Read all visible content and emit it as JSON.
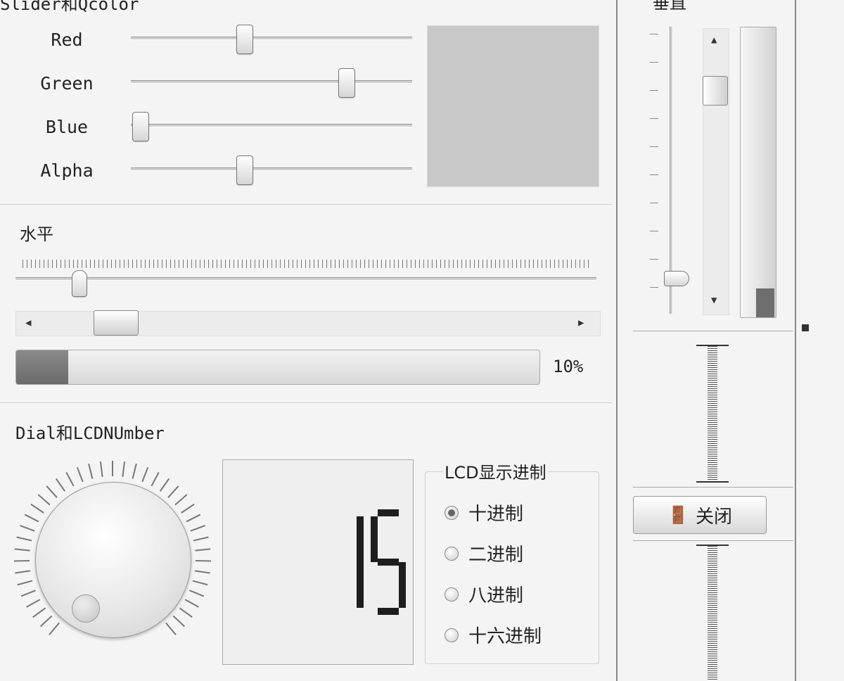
{
  "rgb_group": {
    "title": "Slider和Qcolor",
    "sliders": [
      {
        "label": "Red",
        "value": 0.4
      },
      {
        "label": "Green",
        "value": 0.76
      },
      {
        "label": "Blue",
        "value": 0.0
      },
      {
        "label": "Alpha",
        "value": 0.4
      }
    ],
    "preview_color": "#c8c8c8"
  },
  "horizontal_group": {
    "title": "水平",
    "slider_value": 0.11,
    "scrollbar_value": 0.16,
    "progress": {
      "value": 0.1,
      "text": "10%"
    }
  },
  "dial_group": {
    "title": "Dial和LCDNUmber",
    "lcd_value": "15",
    "radix_group": {
      "title": "LCD显示进制",
      "options": [
        {
          "label": "十进制",
          "checked": true
        },
        {
          "label": "二进制",
          "checked": false
        },
        {
          "label": "八进制",
          "checked": false
        },
        {
          "label": "十六进制",
          "checked": false
        }
      ]
    }
  },
  "vertical_group": {
    "title": "垂直",
    "slider_value": 0.12,
    "scrollbar_value": 0.75,
    "progress_value": 0.1
  },
  "close_button": {
    "label": "关闭",
    "icon": "exit-door-icon"
  }
}
